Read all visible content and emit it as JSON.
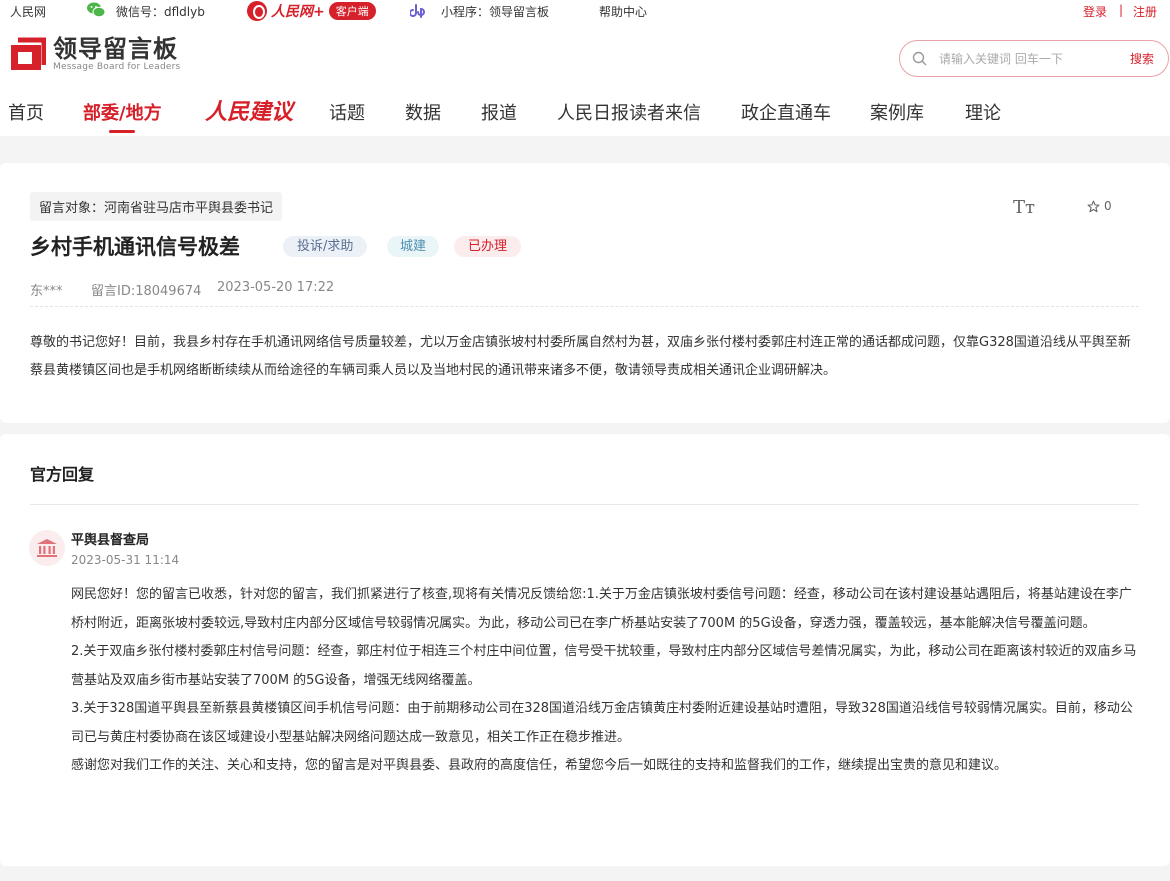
{
  "topbar": {
    "site": "人民网",
    "wechat": "微信号：dfldlyb",
    "rmw_script": "人民网+",
    "rmw_badge": "客户端",
    "miniprogram": "小程序：领导留言板",
    "help": "帮助中心",
    "login": "登录",
    "separator": "|",
    "register": "注册"
  },
  "brand": {
    "title": "领导留言板",
    "subtitle": "Message Board for Leaders"
  },
  "search": {
    "placeholder": "请输入关键词 回车一下",
    "button": "搜索"
  },
  "nav": {
    "home": "首页",
    "dept": "部委/地方",
    "rmjy": "人民建议",
    "topics": "话题",
    "data": "数据",
    "reports": "报道",
    "letters": "人民日报读者来信",
    "business": "政企直通车",
    "cases": "案例库",
    "theory": "理论"
  },
  "message": {
    "target": "留言对象：河南省驻马店市平舆县委书记",
    "title": "乡村手机通讯信号极差",
    "tags": [
      "投诉/求助",
      "城建",
      "已办理"
    ],
    "author": "东***",
    "id": "留言ID:18049674",
    "datetime": "2023-05-20 17:22",
    "favorites": "0",
    "content": "尊敬的书记您好！目前，我县乡村存在手机通讯网络信号质量较差，尤以万金店镇张坡村村委所属自然村为甚，双庙乡张付楼村委郭庄村连正常的通话都成问题，仅靠G328国道沿线从平舆至新蔡县黄楼镇区间也是手机网络断断续续从而给途径的车辆司乘人员以及当地村民的通讯带来诸多不便，敬请领导责成相关通讯企业调研解决。"
  },
  "reply": {
    "heading": "官方回复",
    "org": "平舆县督查局",
    "date": "2023-05-31 11:14",
    "paragraphs": [
      "网民您好！您的留言已收悉，针对您的留言，我们抓紧进行了核查,现将有关情况反馈给您:1.关于万金店镇张坡村委信号问题：经查，移动公司在该村建设基站遇阻后，将基站建设在李广桥村附近，距离张坡村委较远,导致村庄内部分区域信号较弱情况属实。为此，移动公司已在李广桥基站安装了700M 的5G设备，穿透力强，覆盖较远，基本能解决信号覆盖问题。",
      "2.关于双庙乡张付楼村委郭庄村信号问题：经查，郭庄村位于相连三个村庄中间位置，信号受干扰较重，导致村庄内部分区域信号差情况属实，为此，移动公司在距离该村较近的双庙乡马营基站及双庙乡街市基站安装了700M 的5G设备，增强无线网络覆盖。",
      "3.关于328国道平舆县至新蔡县黄楼镇区间手机信号问题：由于前期移动公司在328国道沿线万金店镇黄庄村委附近建设基站时遭阻，导致328国道沿线信号较弱情况属实。目前，移动公司已与黄庄村委协商在该区域建设小型基站解决网络问题达成一致意见，相关工作正在稳步推进。",
      "感谢您对我们工作的关注、关心和支持，您的留言是对平舆县委、县政府的高度信任，希望您今后一如既往的支持和监督我们的工作，继续提出宝贵的意见和建议。"
    ]
  },
  "colors": {
    "brand_red": "#d6202a",
    "page_bg": "#f4f4f4"
  }
}
